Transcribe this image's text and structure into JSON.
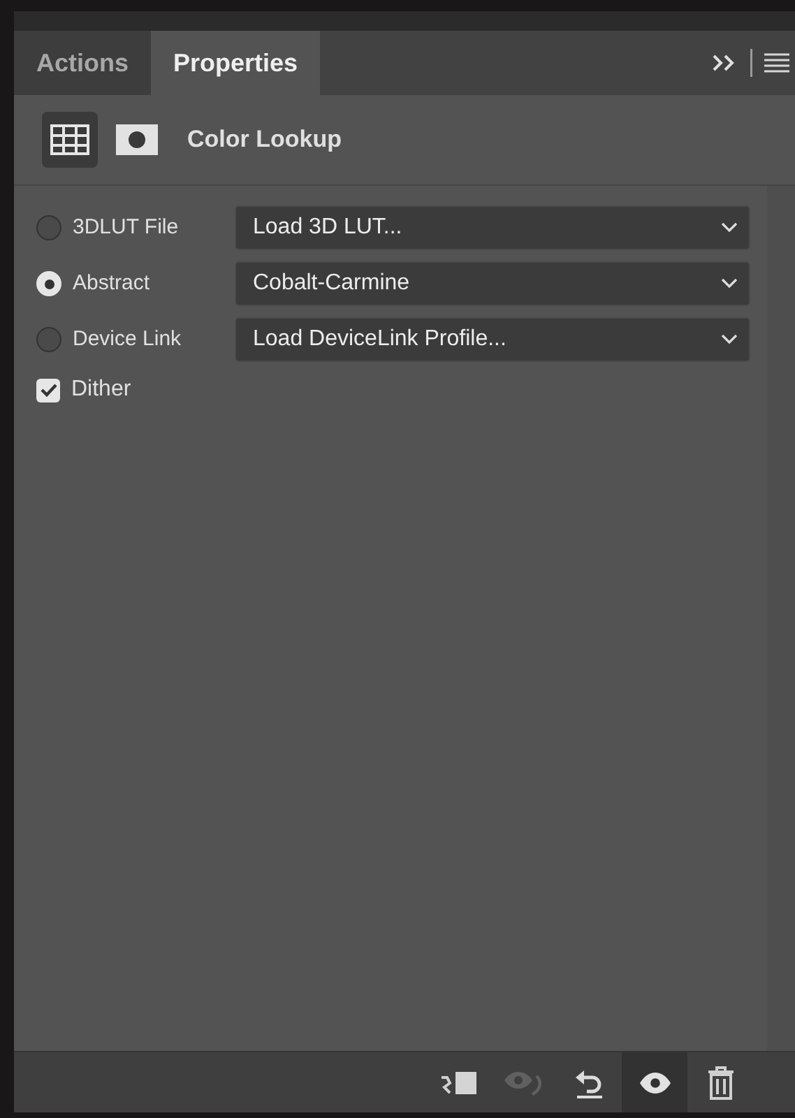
{
  "tabs": [
    {
      "label": "Actions",
      "selected": false
    },
    {
      "label": "Properties",
      "selected": true
    }
  ],
  "header": {
    "title": "Color Lookup",
    "modes": [
      {
        "kind": "adjustment",
        "selected": true
      },
      {
        "kind": "mask",
        "selected": false
      }
    ]
  },
  "options": [
    {
      "label": "3DLUT File",
      "selected": false,
      "value": "Load 3D LUT..."
    },
    {
      "label": "Abstract",
      "selected": true,
      "value": "Cobalt-Carmine"
    },
    {
      "label": "Device Link",
      "selected": false,
      "value": "Load DeviceLink Profile..."
    }
  ],
  "dither": {
    "label": "Dither",
    "checked": true
  },
  "footer_buttons": [
    {
      "kind": "clip",
      "selected": false,
      "disabled": false
    },
    {
      "kind": "view-previous",
      "selected": false,
      "disabled": true
    },
    {
      "kind": "reset",
      "selected": false,
      "disabled": false
    },
    {
      "kind": "visibility",
      "selected": true,
      "disabled": false
    },
    {
      "kind": "delete",
      "selected": false,
      "disabled": false
    }
  ]
}
